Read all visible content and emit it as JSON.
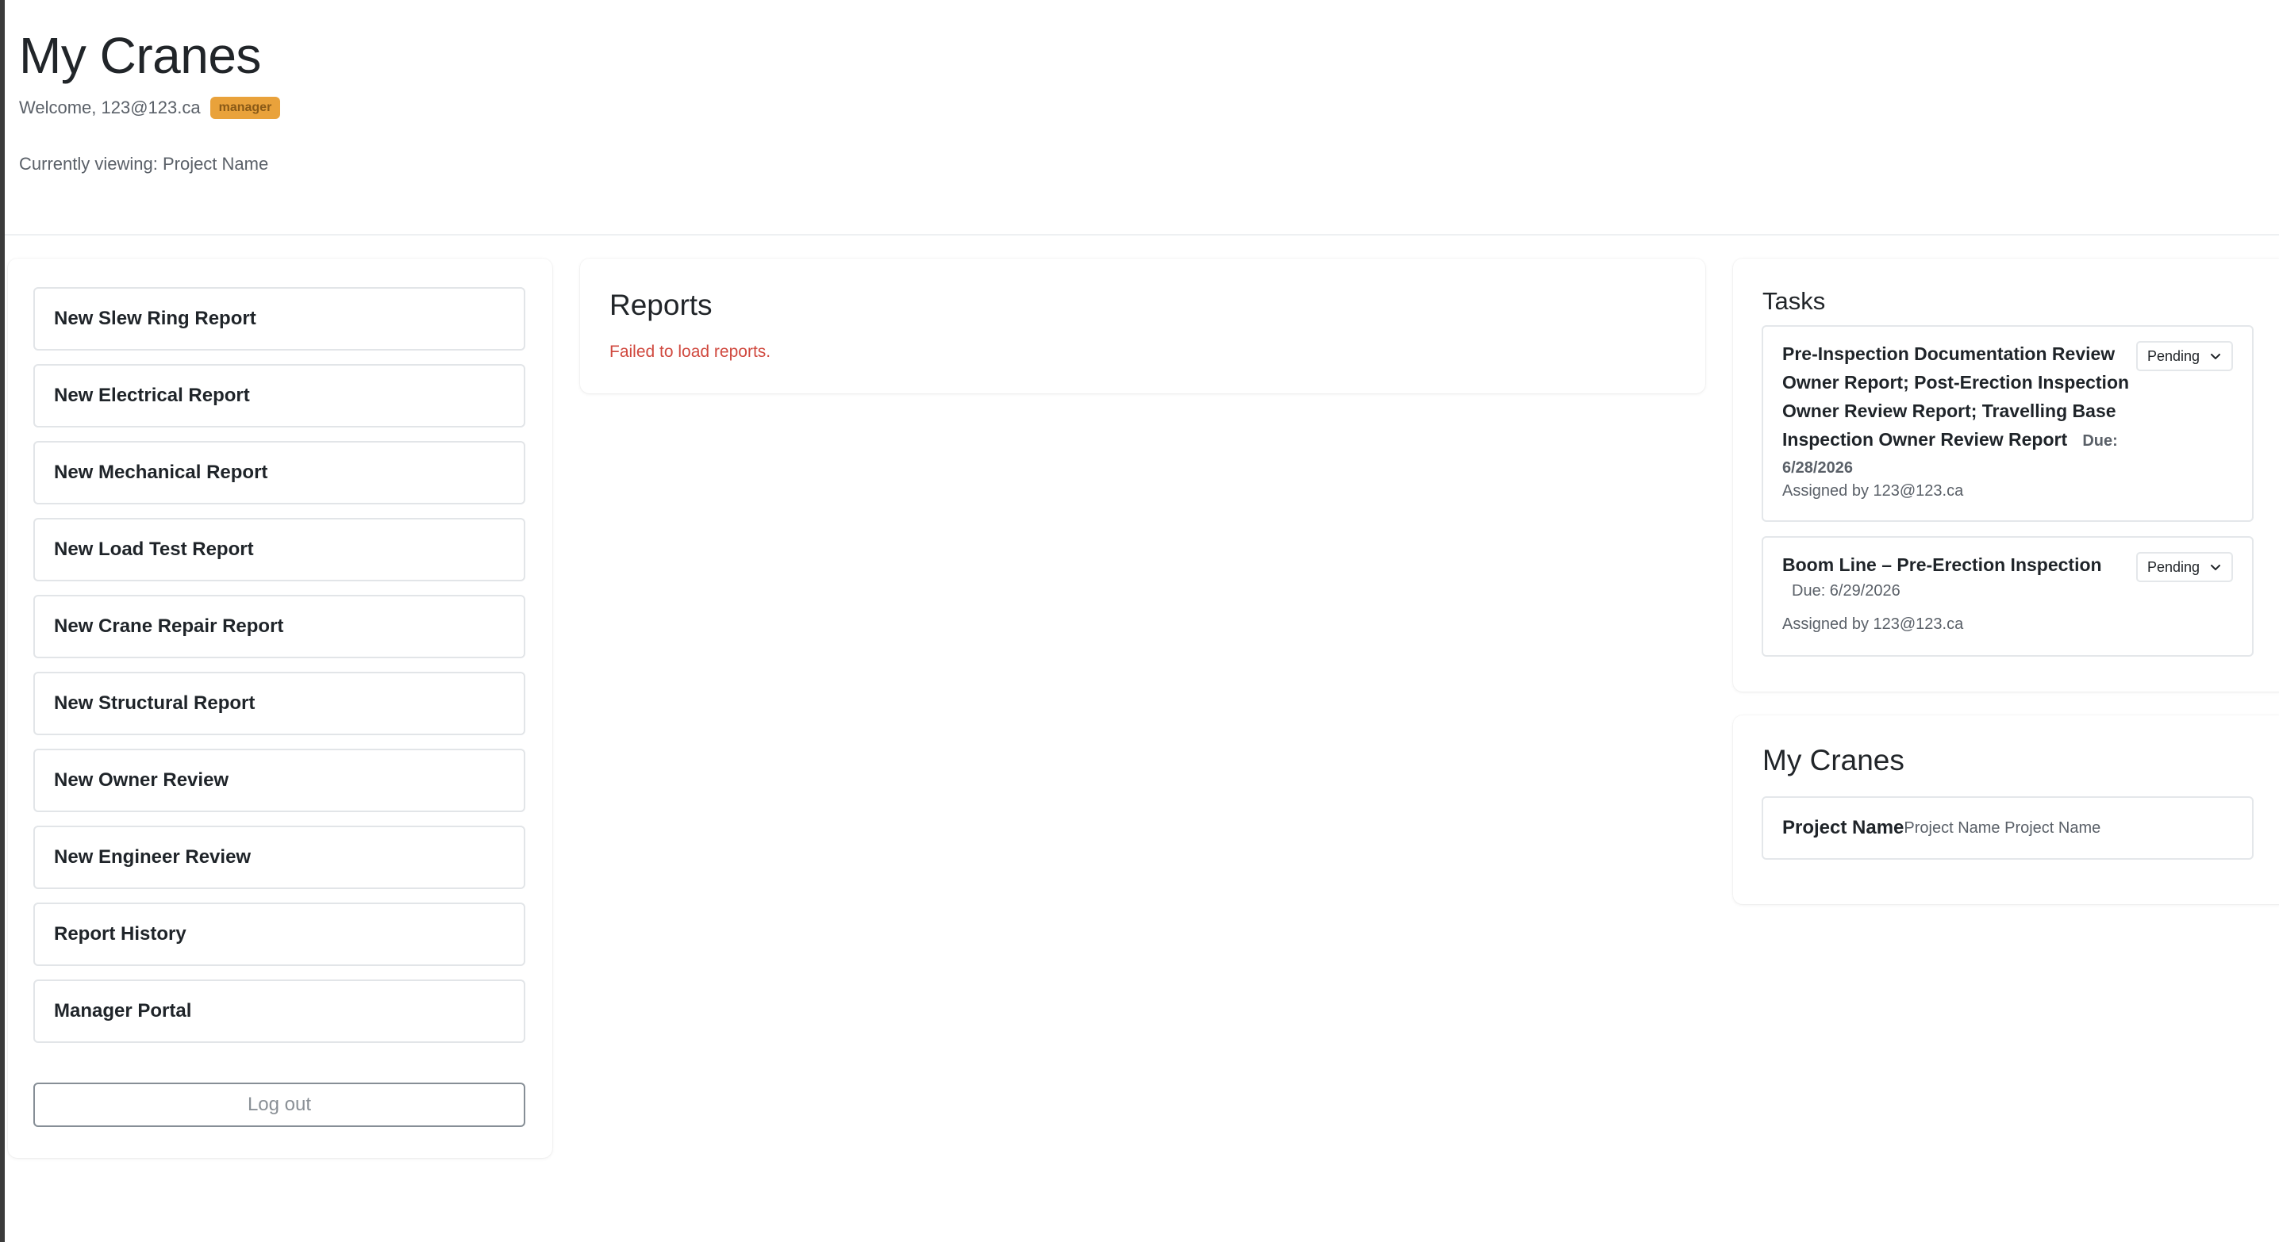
{
  "header": {
    "title": "My Cranes",
    "welcome": "Welcome, 123@123.ca",
    "role_badge": "manager",
    "viewing": "Currently viewing: Project Name"
  },
  "sidebar": {
    "items": [
      {
        "label": "New Slew Ring Report"
      },
      {
        "label": "New Electrical Report"
      },
      {
        "label": "New Mechanical Report"
      },
      {
        "label": "New Load Test Report"
      },
      {
        "label": "New Crane Repair Report"
      },
      {
        "label": "New Structural Report"
      },
      {
        "label": "New Owner Review"
      },
      {
        "label": "New Engineer Review"
      },
      {
        "label": "Report History"
      },
      {
        "label": "Manager Portal"
      }
    ],
    "logout_label": "Log out"
  },
  "reports": {
    "title": "Reports",
    "error": "Failed to load reports."
  },
  "tasks": {
    "title": "Tasks",
    "items": [
      {
        "title_lines": [
          "Pre-Inspection Documentation Review",
          "Owner Report; Post-Erection Inspection",
          "Owner Review Report; Travelling Base",
          "Inspection Owner Review Report"
        ],
        "due": "Due:",
        "due_date": "6/28/2026",
        "assigned": "Assigned by 123@123.ca",
        "status": "Pending"
      },
      {
        "title_lines": [
          "Boom Line – Pre-Erection Inspection"
        ],
        "due": "Due: 6/29/2026",
        "assigned": "Assigned by 123@123.ca",
        "status": "Pending"
      }
    ]
  },
  "cranes": {
    "title": "My Cranes",
    "items": [
      {
        "name": "Project Name",
        "detail": "Project Name Project Name"
      }
    ]
  },
  "colors": {
    "badge": "#e9a23b",
    "error": "#d0493f",
    "border": "#e2e5e8"
  }
}
